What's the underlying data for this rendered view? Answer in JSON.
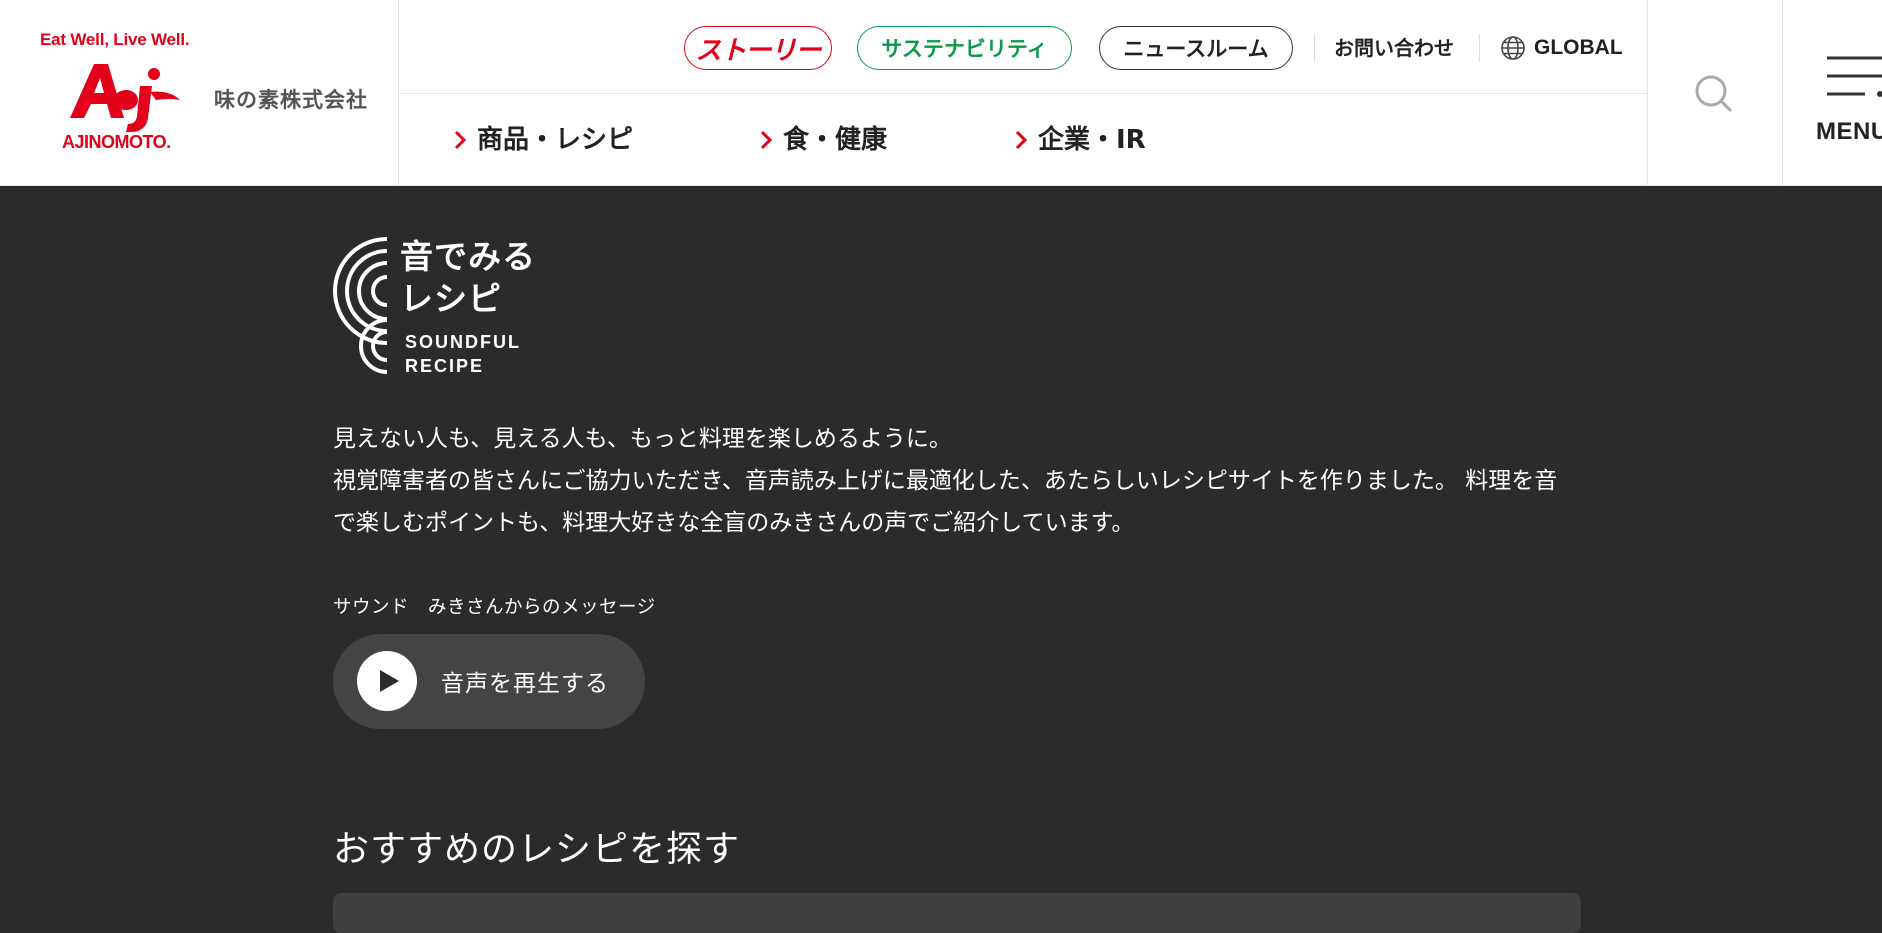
{
  "header": {
    "tagline": "Eat Well, Live Well.",
    "brand_word": "AJINOMOTO.",
    "company_name": "味の素株式会社",
    "pills": {
      "story": "ストーリー",
      "sustainability": "サステナビリティ",
      "newsroom": "ニュースルーム"
    },
    "contact": "お問い合わせ",
    "global": "GLOBAL",
    "nav": [
      "商品・レシピ",
      "食・健康",
      "企業・IR"
    ],
    "menu_label": "MENU"
  },
  "logo": {
    "title": "音でみる\nレシピ",
    "subtitle": "SOUNDFUL\nRECIPE"
  },
  "intro": {
    "line1": "見えない人も、見える人も、もっと料理を楽しめるように。",
    "line2": "視覚障害者の皆さんにご協力いただき、音声読み上げに最適化した、あたらしいレシピサイトを作りました。 料理を音で楽しむポイントも、料理大好きな全盲のみきさんの声でご紹介しています。"
  },
  "audio": {
    "label": "サウンド　みきさんからのメッセージ",
    "play_label": "音声を再生する"
  },
  "section": {
    "heading": "おすすめのレシピを探す"
  },
  "colors": {
    "brand_red": "#e3001b",
    "sustain_green": "#0a9a48",
    "page_bg": "#2b2b2b"
  },
  "icons": [
    "globe-icon",
    "chevron-right-icon",
    "search-icon",
    "menu-icon",
    "play-icon"
  ]
}
